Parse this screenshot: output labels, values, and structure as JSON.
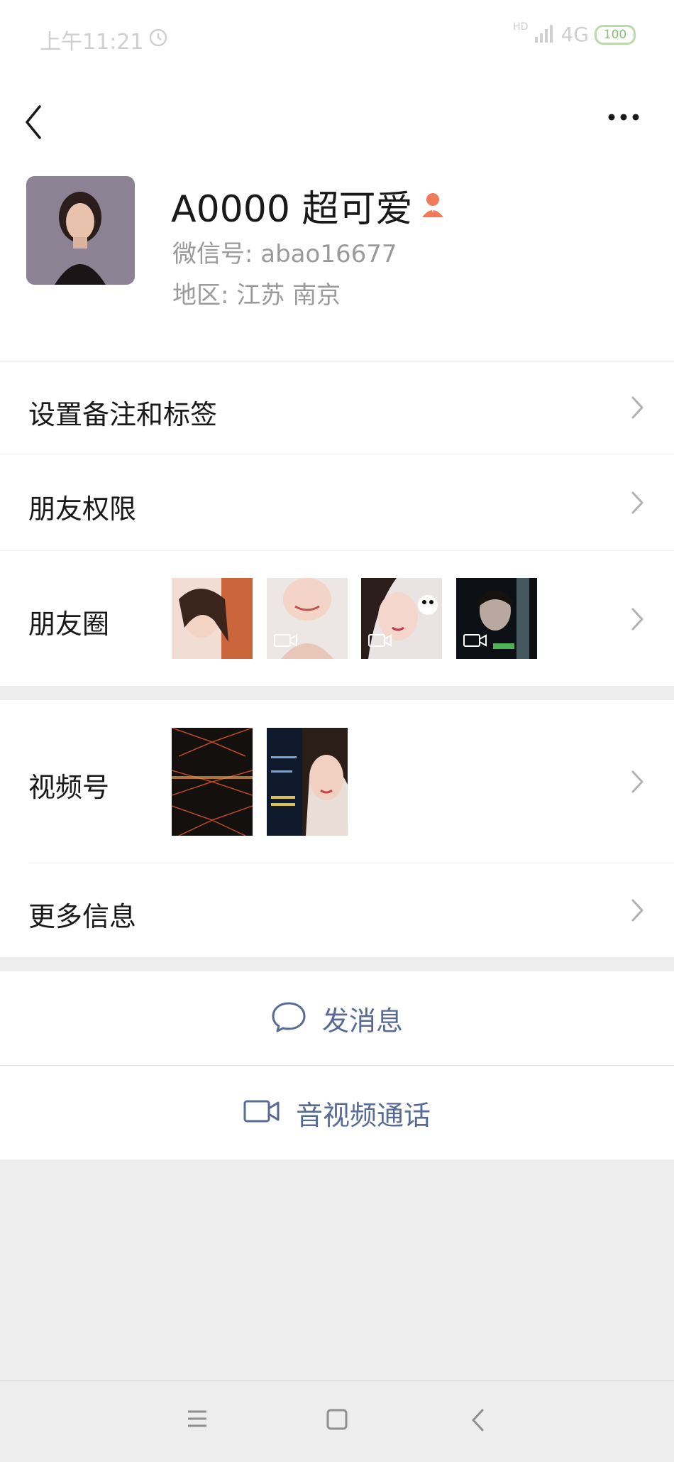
{
  "status_bar": {
    "time": "上午11:21",
    "network": "4G",
    "network_hd": "HD",
    "battery": "100"
  },
  "profile": {
    "name": "A0000 超可爱",
    "wechat_id": "微信号: abao16677",
    "region": "地区: 江苏  南京"
  },
  "menu": {
    "remark_tags": "设置备注和标签",
    "permissions": "朋友权限",
    "moments": "朋友圈",
    "channels": "视频号",
    "more_info": "更多信息"
  },
  "actions": {
    "send_message": "发消息",
    "video_call": "音视频通话"
  },
  "colors": {
    "link_blue": "#576b95",
    "background": "#ededed",
    "badge_orange": "#f07a5c"
  },
  "icons": [
    "back-icon",
    "more-icon",
    "chevron-right-icon",
    "chat-bubble-icon",
    "video-camera-icon",
    "menu-icon",
    "home-square-icon",
    "back-triangle-icon"
  ]
}
